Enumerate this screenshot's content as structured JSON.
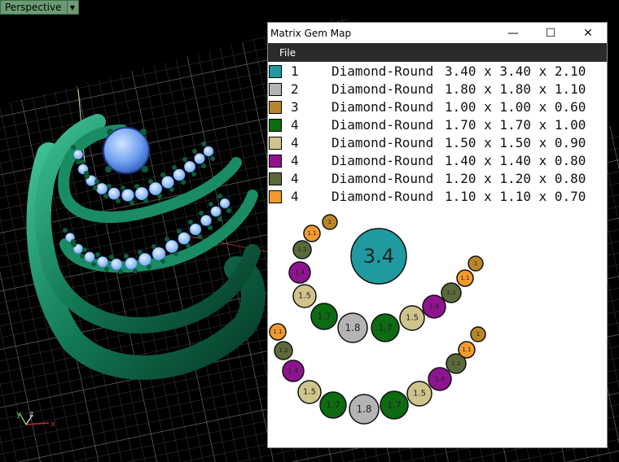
{
  "viewport": {
    "label": "Perspective",
    "axes": {
      "y": "y",
      "z": "z",
      "x": "x"
    }
  },
  "window": {
    "title": "Matrix Gem Map",
    "controls": {
      "minimize": "—",
      "maximize": "☐",
      "close": "✕"
    },
    "menu": [
      "File"
    ]
  },
  "colors": {
    "teal": "#1e9aa0",
    "gray": "#b4b4b4",
    "ochre": "#b8862a",
    "dark_green": "#0d6b12",
    "khaki": "#cfc48c",
    "purple": "#8f138f",
    "olive": "#5b6a3a",
    "orange": "#f29a2e"
  },
  "gems": [
    {
      "qty": "1",
      "shape": "Diamond-Round",
      "size": "3.40 x 3.40 x 2.10",
      "color": "#1e9aa0"
    },
    {
      "qty": "2",
      "shape": "Diamond-Round",
      "size": "1.80 x 1.80 x 1.10",
      "color": "#b4b4b4"
    },
    {
      "qty": "3",
      "shape": "Diamond-Round",
      "size": "1.00 x 1.00 x 0.60",
      "color": "#b8862a"
    },
    {
      "qty": "4",
      "shape": "Diamond-Round",
      "size": "1.70 x 1.70 x 1.00",
      "color": "#0d6b12"
    },
    {
      "qty": "4",
      "shape": "Diamond-Round",
      "size": "1.50 x 1.50 x 0.90",
      "color": "#cfc48c"
    },
    {
      "qty": "4",
      "shape": "Diamond-Round",
      "size": "1.40 x 1.40 x 0.80",
      "color": "#8f138f"
    },
    {
      "qty": "4",
      "shape": "Diamond-Round",
      "size": "1.20 x 1.20 x 0.80",
      "color": "#5b6a3a"
    },
    {
      "qty": "4",
      "shape": "Diamond-Round",
      "size": "1.10 x 1.10 x 0.70",
      "color": "#f29a2e"
    }
  ],
  "map_gems": [
    {
      "label": "3.4",
      "color": "#1e9aa0"
    },
    {
      "label": "1",
      "color": "#b8862a"
    },
    {
      "label": "1.1",
      "color": "#f29a2e"
    },
    {
      "label": "1.2",
      "color": "#5b6a3a"
    },
    {
      "label": "1.4",
      "color": "#8f138f"
    },
    {
      "label": "1.5",
      "color": "#cfc48c"
    },
    {
      "label": "1.7",
      "color": "#0d6b12"
    },
    {
      "label": "1.8",
      "color": "#b4b4b4"
    },
    {
      "label": "1.7",
      "color": "#0d6b12"
    },
    {
      "label": "1.5",
      "color": "#cfc48c"
    },
    {
      "label": "1.4",
      "color": "#8f138f"
    },
    {
      "label": "1.2",
      "color": "#5b6a3a"
    },
    {
      "label": "1.1",
      "color": "#f29a2e"
    },
    {
      "label": "1",
      "color": "#b8862a"
    },
    {
      "label": "1.1",
      "color": "#f29a2e"
    },
    {
      "label": "1.2",
      "color": "#5b6a3a"
    },
    {
      "label": "1.4",
      "color": "#8f138f"
    },
    {
      "label": "1.5",
      "color": "#cfc48c"
    },
    {
      "label": "1.7",
      "color": "#0d6b12"
    },
    {
      "label": "1.8",
      "color": "#b4b4b4"
    },
    {
      "label": "1.7",
      "color": "#0d6b12"
    },
    {
      "label": "1.5",
      "color": "#cfc48c"
    },
    {
      "label": "1.4",
      "color": "#8f138f"
    },
    {
      "label": "1.2",
      "color": "#5b6a3a"
    },
    {
      "label": "1.1",
      "color": "#f29a2e"
    },
    {
      "label": "1",
      "color": "#b8862a"
    }
  ]
}
